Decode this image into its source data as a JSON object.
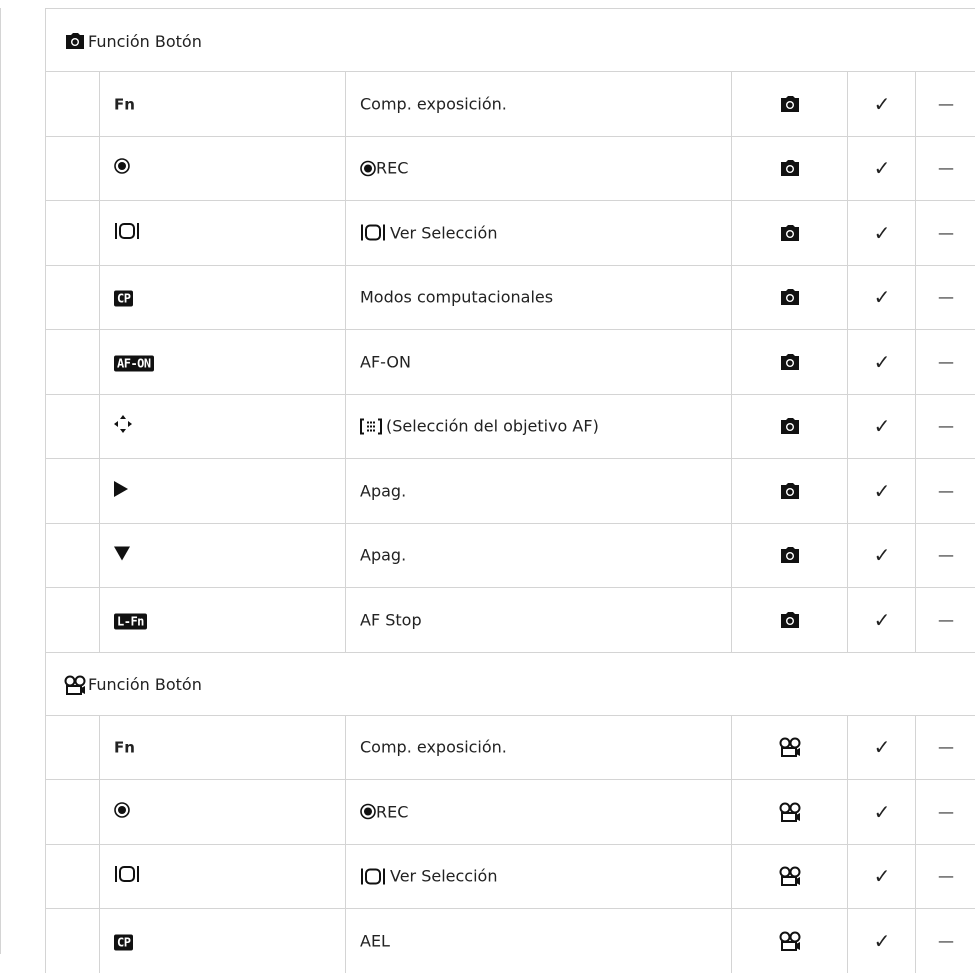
{
  "sections": [
    {
      "title": "Función Botón",
      "mode_icon": "camera-icon",
      "rows": [
        {
          "button": "Fn",
          "button_icon": null,
          "function": "Comp. exposición.",
          "function_icon": null
        },
        {
          "button": "",
          "button_icon": "rec-icon",
          "function": "REC",
          "function_icon": "rec-icon"
        },
        {
          "button": "",
          "button_icon": "preview-icon",
          "function": "Ver Selección",
          "function_icon": "preview-icon"
        },
        {
          "button": "CP",
          "button_icon": "cp-badge-icon",
          "function": "Modos computacionales",
          "function_icon": null
        },
        {
          "button": "AF-ON",
          "button_icon": "af-on-badge-icon",
          "function": "AF-ON",
          "function_icon": null
        },
        {
          "button": "",
          "button_icon": "multi-selector-icon",
          "function": "(Selección del objetivo AF)",
          "function_icon": "af-target-icon"
        },
        {
          "button": "",
          "button_icon": "right-arrow-icon",
          "function": "Apag.",
          "function_icon": null
        },
        {
          "button": "",
          "button_icon": "down-arrow-icon",
          "function": "Apag.",
          "function_icon": null
        },
        {
          "button": "L-Fn",
          "button_icon": "l-fn-badge-icon",
          "function": "AF Stop",
          "function_icon": null
        }
      ]
    },
    {
      "title": "Función Botón",
      "mode_icon": "movie-icon",
      "rows": [
        {
          "button": "Fn",
          "button_icon": null,
          "function": "Comp. exposición.",
          "function_icon": null
        },
        {
          "button": "",
          "button_icon": "rec-icon",
          "function": "REC",
          "function_icon": "rec-icon"
        },
        {
          "button": "",
          "button_icon": "preview-icon",
          "function": "Ver Selección",
          "function_icon": "preview-icon"
        },
        {
          "button": "CP",
          "button_icon": "cp-badge-icon",
          "function": "AEL",
          "function_icon": null
        }
      ]
    }
  ],
  "check_symbol": "✓",
  "dash_symbol": "—"
}
